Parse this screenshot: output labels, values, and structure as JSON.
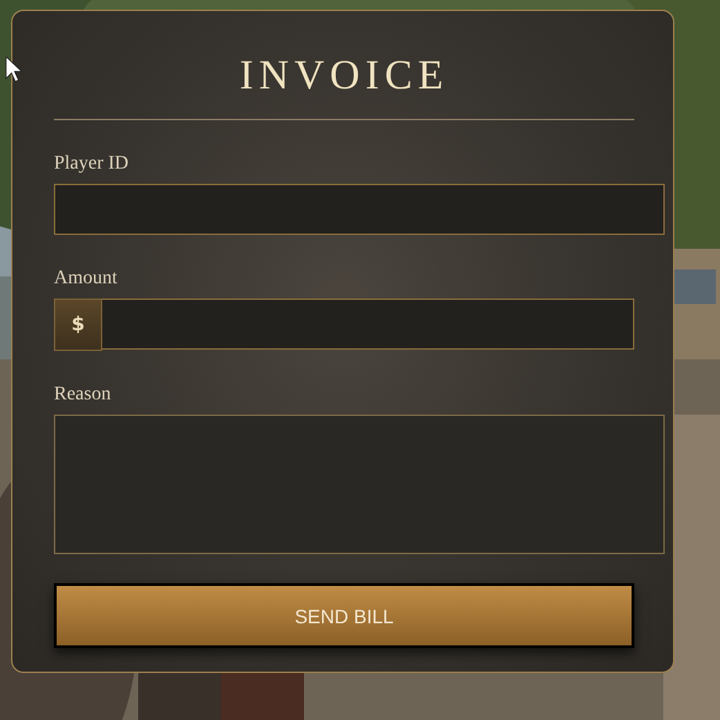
{
  "panel": {
    "title": "INVOICE",
    "fields": [
      {
        "kind": "text",
        "label": "Player ID"
      },
      {
        "kind": "currency",
        "label": "Amount",
        "prefix": "$"
      },
      {
        "kind": "textarea",
        "label": "Reason"
      }
    ],
    "submit_button": "SEND BILL"
  }
}
